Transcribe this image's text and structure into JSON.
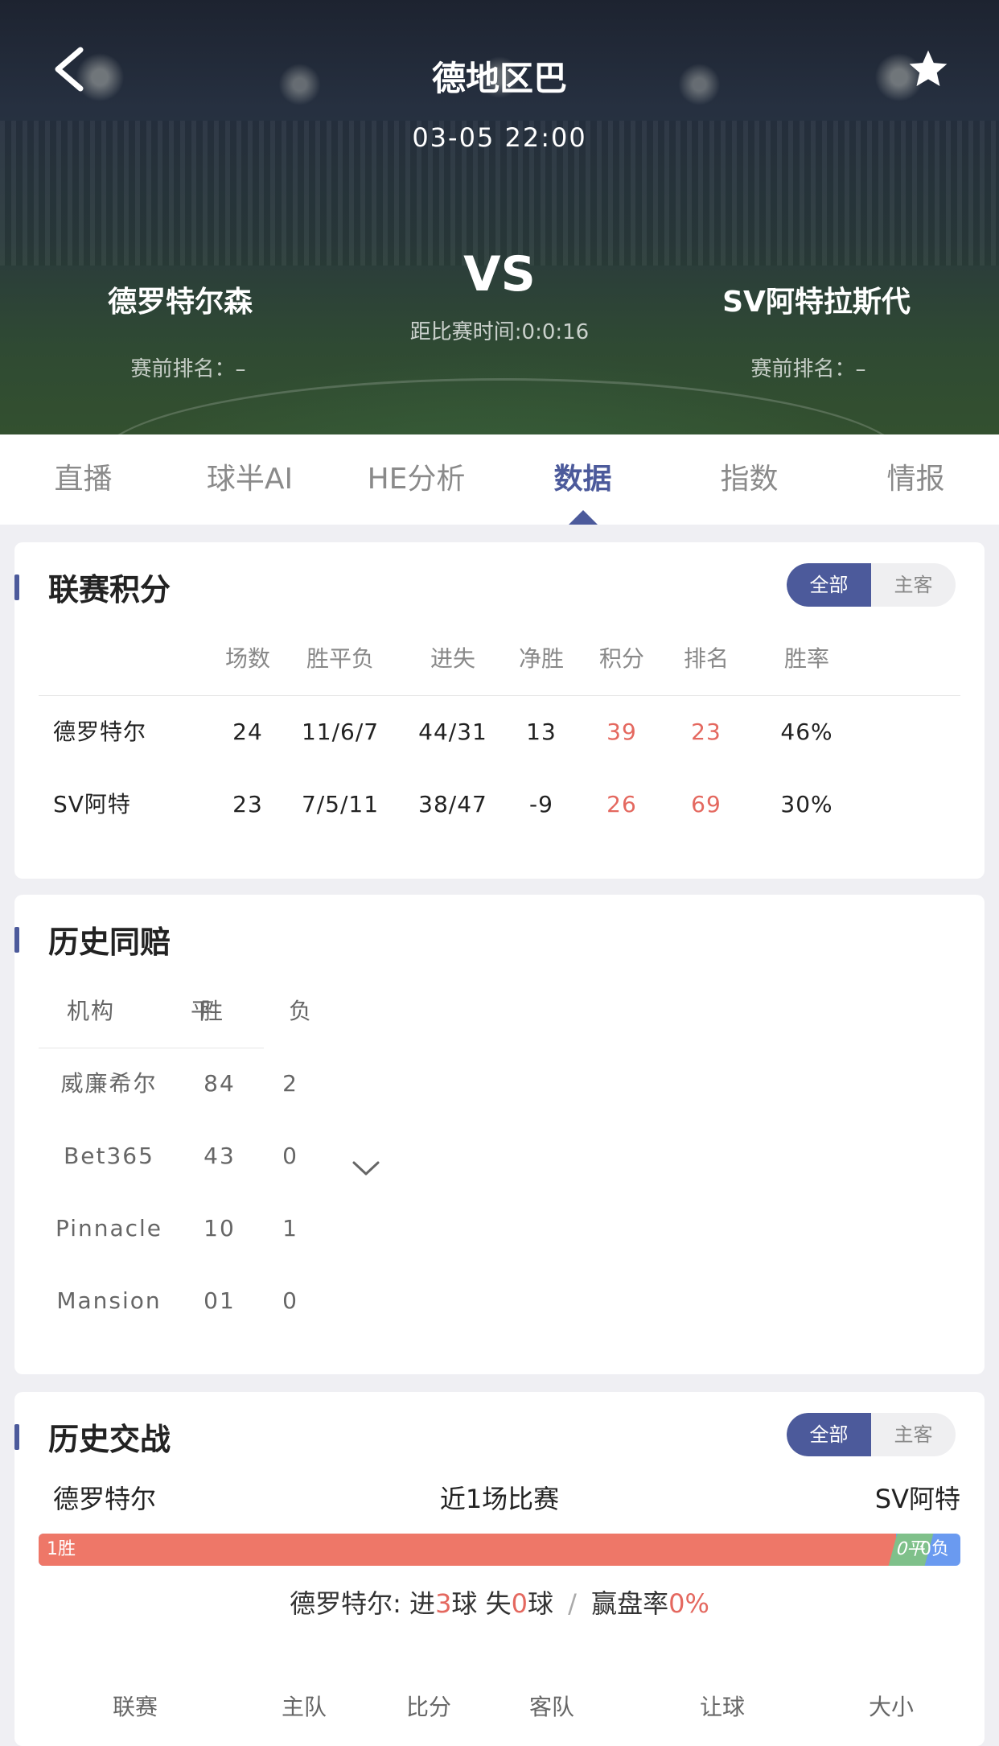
{
  "header": {
    "league": "德地区巴",
    "datetime": "03-05 22:00",
    "home_team": "德罗特尔森",
    "away_team": "SV阿特拉斯代",
    "vs": "VS",
    "countdown": "距比赛时间:0:0:16",
    "home_rank": "赛前排名：–",
    "away_rank": "赛前排名：–"
  },
  "tabs": [
    {
      "label": "直播",
      "active": false
    },
    {
      "label": "球半AI",
      "active": false
    },
    {
      "label": "HE分析",
      "active": false
    },
    {
      "label": "数据",
      "active": true
    },
    {
      "label": "指数",
      "active": false
    },
    {
      "label": "情报",
      "active": false
    }
  ],
  "league_standings": {
    "title": "联赛积分",
    "toggle": {
      "all": "全部",
      "home_away": "主客"
    },
    "columns": [
      "场数",
      "胜平负",
      "进失",
      "净胜",
      "积分",
      "排名",
      "胜率"
    ],
    "rows": [
      {
        "team": "德罗特尔",
        "played": "24",
        "wdl": "11/6/7",
        "gf_ga": "44/31",
        "gd": "13",
        "points": "39",
        "rank": "23",
        "win_rate": "46%"
      },
      {
        "team": "SV阿特",
        "played": "23",
        "wdl": "7/5/11",
        "gf_ga": "38/47",
        "gd": "-9",
        "points": "26",
        "rank": "69",
        "win_rate": "30%"
      }
    ]
  },
  "same_odds_history": {
    "title": "历史同赔",
    "columns": {
      "org": "机构",
      "win": "胜",
      "draw": "平",
      "loss": "负"
    },
    "rows": [
      {
        "org": "威廉希尔",
        "wd": "84",
        "loss": "2"
      },
      {
        "org": "Bet365",
        "wd": "43",
        "loss": "0"
      },
      {
        "org": "Pinnacle",
        "wd": "10",
        "loss": "1"
      },
      {
        "org": "Mansion",
        "wd": "01",
        "loss": "0"
      }
    ]
  },
  "head_to_head": {
    "title": "历史交战",
    "toggle": {
      "all": "全部",
      "home_away": "主客"
    },
    "home": "德罗特尔",
    "away": "SV阿特",
    "recent": "近1场比赛",
    "bar": {
      "win_label": "1胜",
      "draw_label": "0平",
      "loss_label": "0负",
      "win": 1,
      "draw": 0,
      "loss": 0
    },
    "summary": {
      "team": "德罗特尔:",
      "goals_for_pre": "进",
      "goals_for": "3",
      "goals_for_post": "球",
      "goals_against_pre": "失",
      "goals_against": "0",
      "goals_against_post": "球",
      "sep": "/",
      "cover_pre": "赢盘率",
      "cover_rate": "0%"
    },
    "columns": [
      "联赛",
      "主队",
      "比分",
      "客队",
      "让球",
      "大小"
    ]
  }
}
